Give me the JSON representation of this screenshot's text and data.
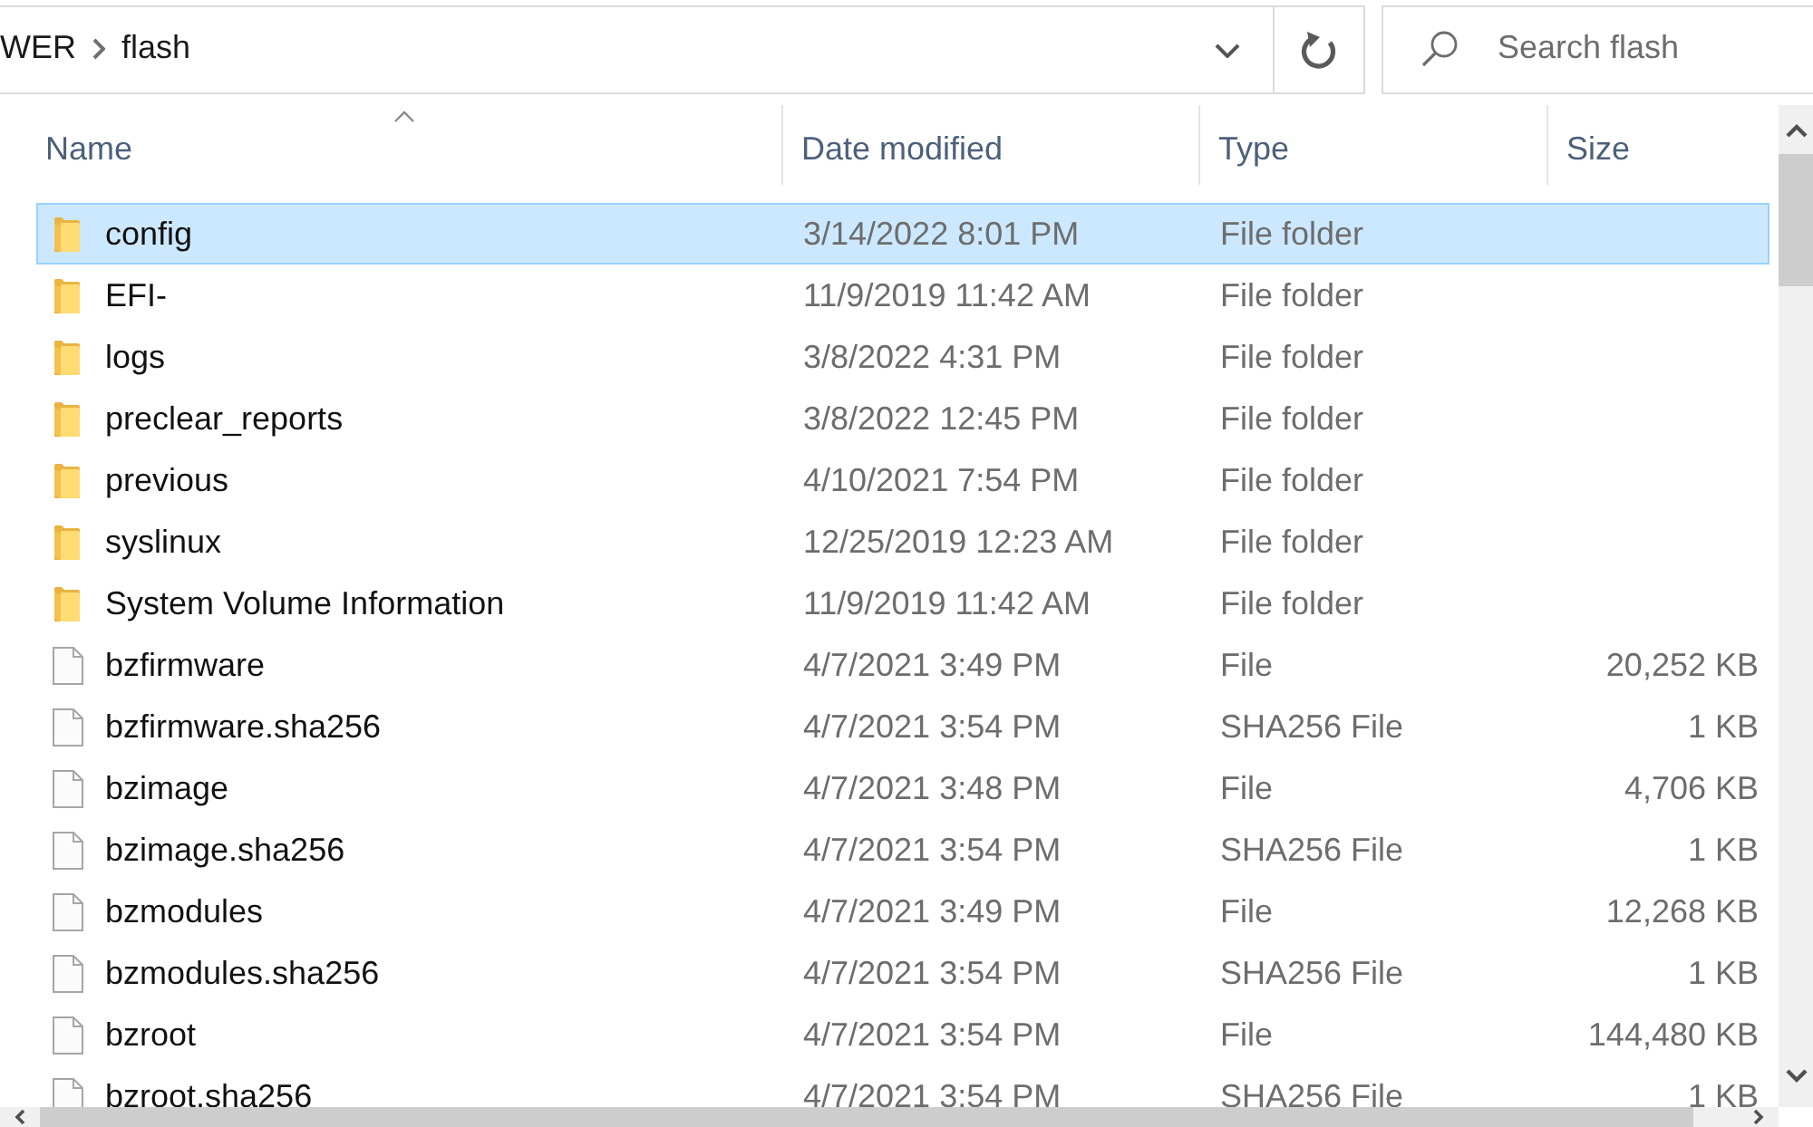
{
  "address_bar": {
    "breadcrumbs": [
      "WER",
      "flash"
    ]
  },
  "search": {
    "placeholder": "Search flash"
  },
  "columns": [
    {
      "label": "Name",
      "sorted": true
    },
    {
      "label": "Date modified",
      "sorted": false
    },
    {
      "label": "Type",
      "sorted": false
    },
    {
      "label": "Size",
      "sorted": false
    }
  ],
  "rows": [
    {
      "kind": "folder",
      "name": "config",
      "date_modified": "3/14/2022 8:01 PM",
      "type": "File folder",
      "selected": true
    },
    {
      "kind": "folder",
      "name": "EFI-",
      "date_modified": "11/9/2019 11:42 AM",
      "type": "File folder",
      "selected": false
    },
    {
      "kind": "folder",
      "name": "logs",
      "date_modified": "3/8/2022 4:31 PM",
      "type": "File folder",
      "selected": false
    },
    {
      "kind": "folder",
      "name": "preclear_reports",
      "date_modified": "3/8/2022 12:45 PM",
      "type": "File folder",
      "selected": false
    },
    {
      "kind": "folder",
      "name": "previous",
      "date_modified": "4/10/2021 7:54 PM",
      "type": "File folder",
      "selected": false
    },
    {
      "kind": "folder",
      "name": "syslinux",
      "date_modified": "12/25/2019 12:23 AM",
      "type": "File folder",
      "selected": false
    },
    {
      "kind": "folder",
      "name": "System Volume Information",
      "date_modified": "11/9/2019 11:42 AM",
      "type": "File folder",
      "selected": false
    },
    {
      "kind": "file",
      "name": "bzfirmware",
      "date_modified": "4/7/2021 3:49 PM",
      "type": "File",
      "size": "20,252 KB",
      "selected": false
    },
    {
      "kind": "file",
      "name": "bzfirmware.sha256",
      "date_modified": "4/7/2021 3:54 PM",
      "type": "SHA256 File",
      "size": "1 KB",
      "selected": false
    },
    {
      "kind": "file",
      "name": "bzimage",
      "date_modified": "4/7/2021 3:48 PM",
      "type": "File",
      "size": "4,706 KB",
      "selected": false
    },
    {
      "kind": "file",
      "name": "bzimage.sha256",
      "date_modified": "4/7/2021 3:54 PM",
      "type": "SHA256 File",
      "size": "1 KB",
      "selected": false
    },
    {
      "kind": "file",
      "name": "bzmodules",
      "date_modified": "4/7/2021 3:49 PM",
      "type": "File",
      "size": "12,268 KB",
      "selected": false
    },
    {
      "kind": "file",
      "name": "bzmodules.sha256",
      "date_modified": "4/7/2021 3:54 PM",
      "type": "SHA256 File",
      "size": "1 KB",
      "selected": false
    },
    {
      "kind": "file",
      "name": "bzroot",
      "date_modified": "4/7/2021 3:54 PM",
      "type": "File",
      "size": "144,480 KB",
      "selected": false
    },
    {
      "kind": "file",
      "name": "bzroot.sha256",
      "date_modified": "4/7/2021 3:54 PM",
      "type": "SHA256 File",
      "size": "1 KB",
      "selected": false
    }
  ]
}
